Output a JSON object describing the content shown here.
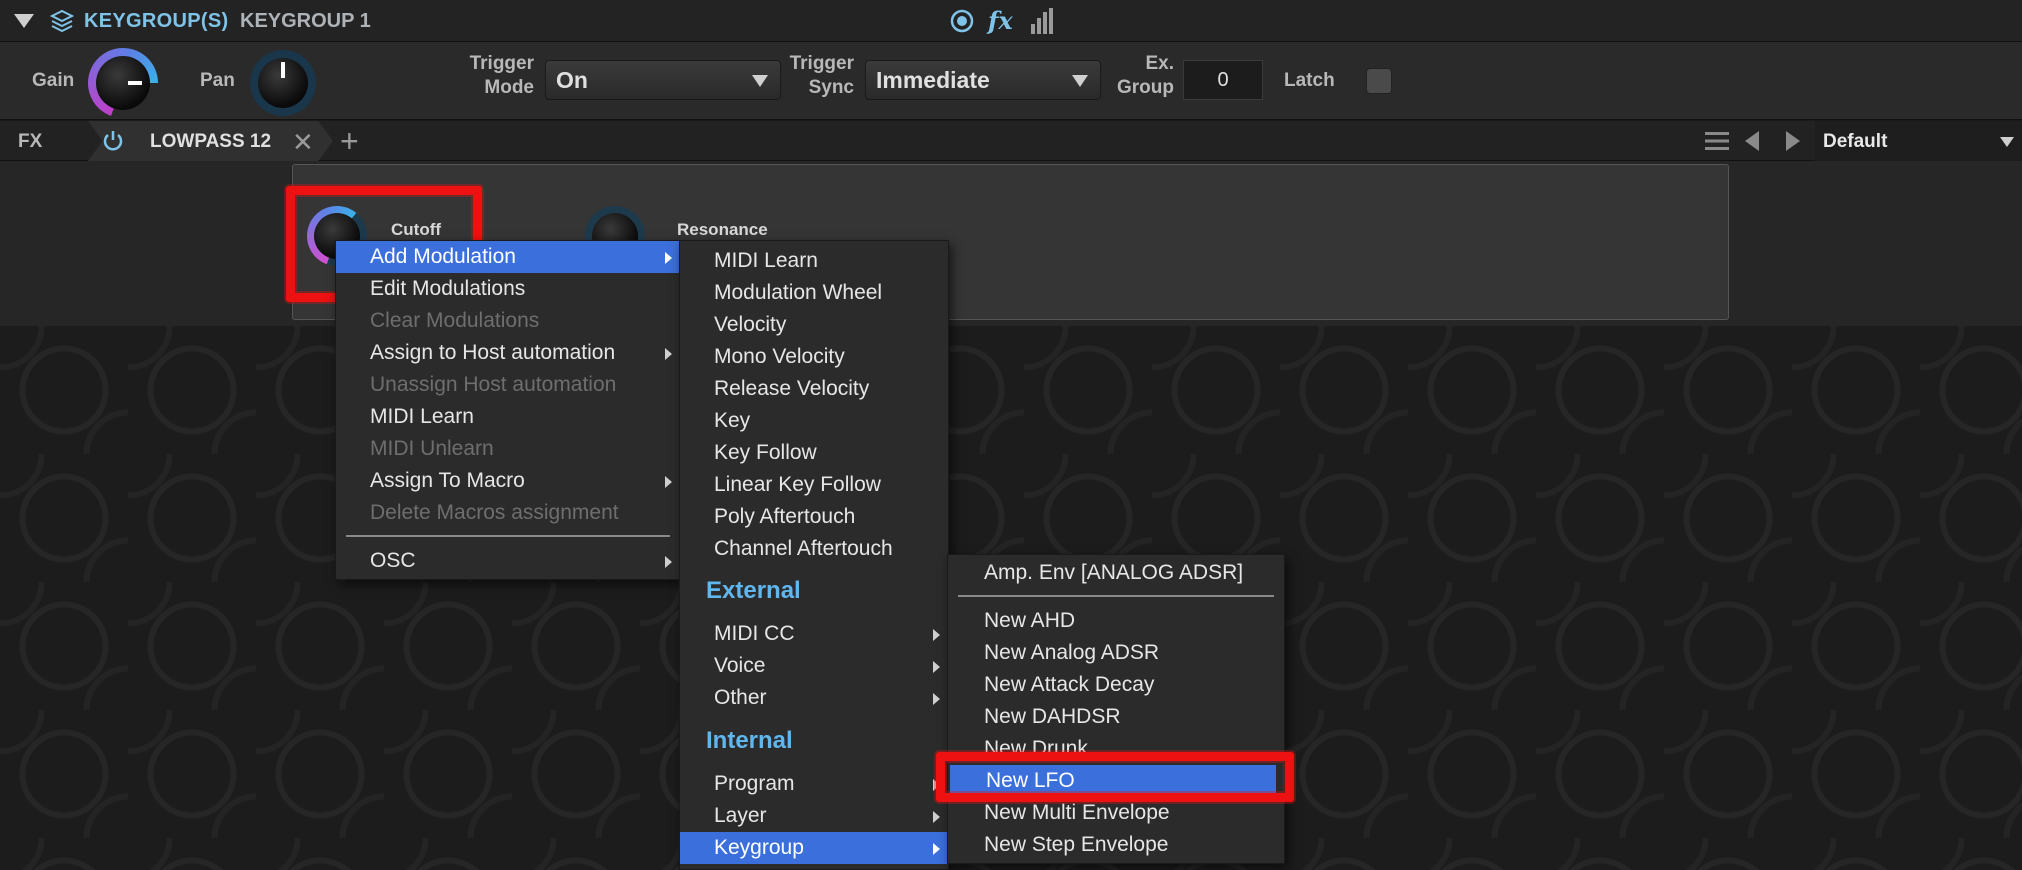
{
  "title_bar": {
    "type_label": "KEYGROUP(S)",
    "name": "KEYGROUP 1"
  },
  "controls": {
    "gain_label": "Gain",
    "pan_label": "Pan",
    "trigger_mode_label_1": "Trigger",
    "trigger_mode_label_2": "Mode",
    "trigger_mode_value": "On",
    "trigger_sync_label_1": "Trigger",
    "trigger_sync_label_2": "Sync",
    "trigger_sync_value": "Immediate",
    "ex_group_label_1": "Ex.",
    "ex_group_label_2": "Group",
    "ex_group_value": "0",
    "latch_label": "Latch"
  },
  "fx_bar": {
    "label": "FX",
    "tab_name": "LOWPASS 12",
    "preset": "Default"
  },
  "fx_panel": {
    "cutoff_label": "Cutoff",
    "resonance_label": "Resonance"
  },
  "context_menu": {
    "items": [
      {
        "label": "Add Modulation",
        "state": "selected",
        "submenu": true
      },
      {
        "label": "Edit Modulations"
      },
      {
        "label": "Clear Modulations",
        "state": "disabled"
      },
      {
        "label": "Assign to Host automation",
        "submenu": true
      },
      {
        "label": "Unassign Host automation",
        "state": "disabled"
      },
      {
        "label": "MIDI Learn"
      },
      {
        "label": "MIDI Unlearn",
        "state": "disabled"
      },
      {
        "label": "Assign To Macro",
        "submenu": true
      },
      {
        "label": "Delete Macros assignment",
        "state": "disabled"
      },
      {
        "label": "OSC",
        "submenu": true
      }
    ]
  },
  "modulation_menu": {
    "items": [
      "MIDI Learn",
      "Modulation Wheel",
      "Velocity",
      "Mono Velocity",
      "Release Velocity",
      "Key",
      "Key Follow",
      "Linear Key Follow",
      "Poly Aftertouch",
      "Channel Aftertouch"
    ],
    "external_header": "External",
    "external_items": [
      "MIDI CC",
      "Voice",
      "Other"
    ],
    "internal_header": "Internal",
    "internal_items": [
      "Program",
      "Layer",
      "Keygroup"
    ],
    "selected": "Keygroup"
  },
  "keygroup_menu": {
    "top_item": "Amp. Env [ANALOG ADSR]",
    "items": [
      "New AHD",
      "New Analog ADSR",
      "New Attack Decay",
      "New DAHDSR",
      "New Drunk",
      "New LFO",
      "New Multi Envelope",
      "New Step Envelope"
    ],
    "selected": "New LFO"
  },
  "colors": {
    "accent_blue": "#7fc4e8",
    "menu_selection": "#3b6fdc",
    "highlight_red": "#ee1111",
    "section_header": "#5fb7ee"
  }
}
